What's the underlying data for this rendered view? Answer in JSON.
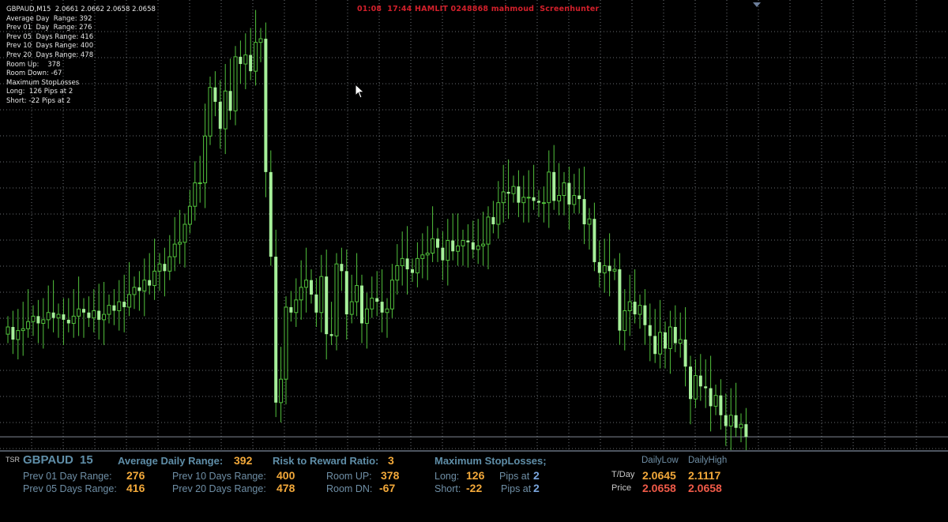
{
  "info": {
    "symbol_line": "GBPAUD,M15  2.0661 2.0662 2.0658 2.0658",
    "lines": [
      "Average Day  Range: 392",
      "Prev 01  Day  Range: 276",
      "Prev 05  Days Range: 416",
      "Prev 10  Days Range: 400",
      "Prev 20  Days Range: 478",
      "Room Up:    378",
      "Room Down: -67",
      "Maximum StopLosses",
      "Long:  126 Pips at 2",
      "Short: -22 Pips at 2"
    ]
  },
  "banner": "01:08  17:44 HAMLIT 0248868 mahmoud  Screenhunter",
  "colors": {
    "background": "#000000",
    "grid": "#8a8f96",
    "candle": "#a6f09a",
    "wick": "#52c23c",
    "price_line": "#7f8893",
    "panel_border": "#4d5560",
    "banner": "#d2202b",
    "value_orange": "#f3a93a",
    "value_blue": "#7aa6dd",
    "value_red": "#f05a48",
    "label": "#6f8fa6"
  },
  "chart_data": {
    "type": "candlestick",
    "symbol": "GBPAUD",
    "timeframe": "M15",
    "last_price": 2.0658,
    "open": [
      2.0615,
      2.0619,
      2.0612,
      2.0617,
      2.0618,
      2.0622,
      2.0625,
      2.0621,
      2.0623,
      2.0627,
      2.0624,
      2.0626,
      2.0623,
      2.0621,
      2.0625,
      2.0629,
      2.0627,
      2.0624,
      2.0628,
      2.0623,
      2.0626,
      2.0631,
      2.0628,
      2.0633,
      2.063,
      2.0637,
      2.0641,
      2.0639,
      2.0645,
      2.0642,
      2.065,
      2.0654,
      2.065,
      2.0658,
      2.0665,
      2.0666,
      2.0676,
      2.0686,
      2.0699,
      2.0699,
      2.0725,
      2.0752,
      2.0744,
      2.0729,
      2.075,
      2.0739,
      2.0769,
      2.0765,
      2.077,
      2.0761,
      2.0777,
      2.0779,
      2.0705,
      2.0658,
      2.0577,
      2.059,
      2.063,
      2.0627,
      2.0634,
      2.0641,
      2.0645,
      2.0637,
      2.0627,
      2.0647,
      2.0615,
      2.0614,
      2.0654,
      2.065,
      2.0626,
      2.0633,
      2.0642,
      2.0621,
      2.0629,
      2.0635,
      2.0633,
      2.0627,
      2.0629,
      2.0645,
      2.0653,
      2.0657,
      2.0651,
      2.0649,
      2.0657,
      2.0659,
      2.066,
      2.0668,
      2.0663,
      2.0656,
      2.0667,
      2.0661,
      2.0664,
      2.0667,
      2.0666,
      2.0662,
      2.0664,
      2.0665,
      2.068,
      2.0676,
      2.0688,
      2.0694,
      2.0693,
      2.0697,
      2.0688,
      2.0691,
      2.0691,
      2.0689,
      2.0688,
      2.0688,
      2.0705,
      2.0689,
      2.0692,
      2.0699,
      2.0687,
      2.0692,
      2.069,
      2.0676,
      2.0679,
      2.0655,
      2.0649,
      2.0653,
      2.065,
      2.0651,
      2.0617,
      2.0628,
      2.0633,
      2.0626,
      2.0631,
      2.062,
      2.0614,
      2.0604,
      2.0616,
      2.0607,
      2.0619,
      2.061,
      2.0612,
      2.0597,
      2.0579,
      2.0592,
      2.0586,
      2.0585,
      2.0575,
      2.0581,
      2.057,
      2.0564,
      2.057,
      2.0563,
      2.0565
    ],
    "close": [
      2.0619,
      2.0612,
      2.0617,
      2.0618,
      2.0622,
      2.0625,
      2.0621,
      2.0623,
      2.0627,
      2.0624,
      2.0626,
      2.0623,
      2.0621,
      2.0625,
      2.0629,
      2.0627,
      2.0624,
      2.0628,
      2.0623,
      2.0626,
      2.0631,
      2.0628,
      2.0633,
      2.063,
      2.0637,
      2.0641,
      2.0639,
      2.0645,
      2.0642,
      2.065,
      2.0654,
      2.065,
      2.0658,
      2.0665,
      2.0666,
      2.0676,
      2.0686,
      2.0699,
      2.0699,
      2.0725,
      2.0752,
      2.0744,
      2.0729,
      2.075,
      2.0739,
      2.0769,
      2.0765,
      2.077,
      2.0761,
      2.0777,
      2.0779,
      2.0705,
      2.0658,
      2.0577,
      2.059,
      2.063,
      2.0627,
      2.0634,
      2.0641,
      2.0645,
      2.0637,
      2.0627,
      2.0647,
      2.0615,
      2.0614,
      2.0654,
      2.065,
      2.0626,
      2.0633,
      2.0642,
      2.0621,
      2.0629,
      2.0635,
      2.0633,
      2.0627,
      2.0629,
      2.0645,
      2.0653,
      2.0657,
      2.0651,
      2.0649,
      2.0657,
      2.0659,
      2.066,
      2.0668,
      2.0663,
      2.0656,
      2.0667,
      2.0661,
      2.0664,
      2.0667,
      2.0666,
      2.0662,
      2.0664,
      2.0665,
      2.068,
      2.0676,
      2.0688,
      2.0694,
      2.0693,
      2.0697,
      2.0688,
      2.0691,
      2.0691,
      2.0689,
      2.0688,
      2.0688,
      2.0705,
      2.0689,
      2.0692,
      2.0699,
      2.0687,
      2.0692,
      2.069,
      2.0676,
      2.0679,
      2.0655,
      2.0649,
      2.0653,
      2.065,
      2.0651,
      2.0617,
      2.0628,
      2.0633,
      2.0626,
      2.0631,
      2.062,
      2.0614,
      2.0604,
      2.0616,
      2.0607,
      2.0619,
      2.061,
      2.0612,
      2.0597,
      2.0579,
      2.0592,
      2.0586,
      2.0585,
      2.0575,
      2.0581,
      2.057,
      2.0564,
      2.057,
      2.0563,
      2.0565,
      2.0558
    ],
    "ylim": [
      2.0555,
      2.079
    ],
    "x_ticks": [],
    "y_ticks": []
  },
  "panel": {
    "tag": "TSR",
    "symbol": "GBPAUD",
    "period": "15",
    "avg_label": "Average Daily Range:",
    "avg_value": "392",
    "rr_label": "Risk to Reward Ratio:",
    "rr_value": "3",
    "msl_label": "Maximum StopLosses;",
    "dl_label": "DailyLow",
    "dh_label": "DailyHigh",
    "prev01_label": "Prev 01 Day Range:",
    "prev01_value": "276",
    "prev05_label": "Prev 05 Days Range:",
    "prev05_value": "416",
    "prev10_label": "Prev 10 Days Range:",
    "prev10_value": "400",
    "prev20_label": "Prev 20 Days Range:",
    "prev20_value": "478",
    "roomup_label": "Room UP:",
    "roomup_value": "378",
    "roomdn_label": "Room DN:",
    "roomdn_value": "-67",
    "long_label": "Long:",
    "long_value": "126",
    "short_label": "Short:",
    "short_value": "-22",
    "pipsat_label": "Pips at",
    "pips_long": "2",
    "pips_short": "2",
    "tday_label": "T/Day",
    "price_label": "Price",
    "tday_low": "2.0645",
    "tday_high": "2.1117",
    "price_low": "2.0658",
    "price_high": "2.0658"
  }
}
